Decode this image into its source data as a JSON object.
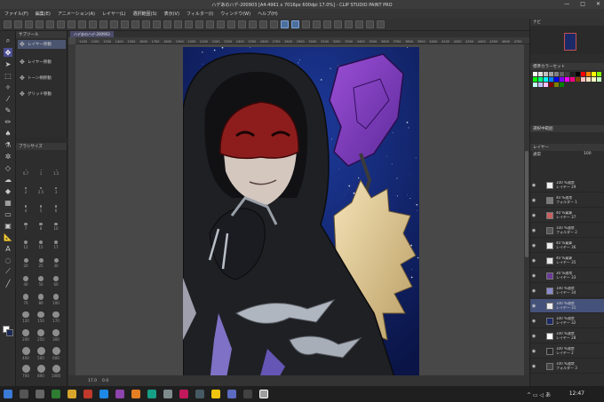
{
  "window": {
    "title": "ハデあのハデ-200903 [A4:4961 x 7016px 600dpi 17.0%] - CLIP STUDIO PAINT PRO",
    "controls": [
      "—",
      "□",
      "✕"
    ]
  },
  "menu": [
    "ファイル(F)",
    "編集(E)",
    "アニメーション(A)",
    "レイヤー(L)",
    "選択範囲(S)",
    "表示(V)",
    "フィルター(I)",
    "ウィンドウ(W)",
    "ヘルプ(H)"
  ],
  "subtool_panel": {
    "header": "サブツール",
    "items": [
      "レイヤー移動",
      "レイヤー移動",
      "トーン柄移動",
      "グリッド移動"
    ]
  },
  "brush_panel": {
    "header": "ブラシサイズ",
    "sizes": [
      "0.7",
      "1",
      "1.5",
      "2",
      "2.5",
      "3",
      "4",
      "5",
      "6",
      "7",
      "8",
      "10",
      "12",
      "15",
      "17",
      "20",
      "25",
      "30",
      "40",
      "50",
      "60",
      "70",
      "80",
      "100",
      "120",
      "150",
      "170",
      "200",
      "250",
      "300",
      "400",
      "500",
      "600",
      "700",
      "800",
      "1000"
    ]
  },
  "document_tab": "ハデあのハデ-200903",
  "ruler_marks": [
    "1100",
    "1200",
    "1300",
    "1400",
    "1500",
    "1600",
    "1700",
    "1800",
    "1900",
    "2000",
    "2100",
    "2200",
    "2300",
    "2400",
    "2500",
    "2600",
    "2700",
    "2800",
    "2900",
    "3000",
    "3100",
    "3200",
    "3300",
    "3400",
    "3500",
    "3600",
    "3700",
    "3800",
    "3900",
    "4000",
    "4100",
    "4200",
    "4300",
    "4400",
    "4500",
    "4600",
    "4700"
  ],
  "statusbar": {
    "zoom": "17.0",
    "angle": "0.0"
  },
  "right_panel": {
    "navigator_label": "ナビ",
    "colorset_header": "標準カラーセット",
    "property_header": "選択中範囲",
    "blend_label": "通常",
    "opacity": "100",
    "layer_header": "レイヤー",
    "layers": [
      {
        "mode": "100 %通常",
        "name": "レイヤー 29",
        "thumb": "#f2f2f2"
      },
      {
        "mode": "40 %通常",
        "name": "フォルダー 1",
        "thumb": "#7a7a7a"
      },
      {
        "mode": "40 %乗算",
        "name": "レイヤー 37",
        "thumb": "#c86060"
      },
      {
        "mode": "100 %通常",
        "name": "フォルダー 2",
        "thumb": "#555"
      },
      {
        "mode": "40 %乗算",
        "name": "レイヤー 36",
        "thumb": "#ededed"
      },
      {
        "mode": "40 %乗算",
        "name": "レイヤー 35",
        "thumb": "#e8e8e8"
      },
      {
        "mode": "30 %通常",
        "name": "レイヤー 33",
        "thumb": "#6a3a96"
      },
      {
        "mode": "100 %通常",
        "name": "レイヤー 34",
        "thumb": "#8a8acb"
      },
      {
        "mode": "100 %通常",
        "name": "レイヤー 31",
        "thumb": "#ededed"
      },
      {
        "mode": "100 %通常",
        "name": "レイヤー 32",
        "thumb": "#1b2a66"
      },
      {
        "mode": "100 %通常",
        "name": "レイヤー 28",
        "thumb": "#ffffff"
      },
      {
        "mode": "100 %通常",
        "name": "レイヤー 2",
        "thumb": "#2a2a2a"
      },
      {
        "mode": "100 %通常",
        "name": "フォルダー 3",
        "thumb": "#444"
      }
    ]
  },
  "taskbar": {
    "time": "12:47",
    "tray": "^ ▭ ◁ あ"
  }
}
